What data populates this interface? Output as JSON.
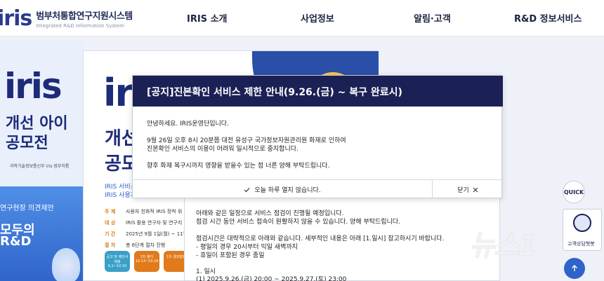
{
  "header": {
    "logo_mark": "iris",
    "logo_title": "범부처통합연구지원시스템",
    "logo_sub": "Integrated R&D Information System",
    "nav": [
      "IRIS 소개",
      "사업정보",
      "알림·고객",
      "R&D 정보서비스"
    ]
  },
  "banner_left": {
    "brand": "iris",
    "line1": "개선 아이",
    "line2": "공모전",
    "org": "과학기술정보통신부  iris 범부처통",
    "blue_t1": "연구현장 의견제안",
    "blue_t2": "모두의",
    "blue_t3": "R&D"
  },
  "card1": {
    "brand": "iris",
    "big1": "개선",
    "big2": "공모",
    "sub1": "IRIS 서비스",
    "sub2": "IRIS 사용자",
    "rows": [
      {
        "k": "주  제",
        "v": "사용자 친화적 IRIS 정착 위"
      },
      {
        "k": "대  상",
        "v": "IRIS 활용 연구자 및 연구지"
      },
      {
        "k": "기  간",
        "v": "2025년 9월 1일(월) ~ 11월"
      },
      {
        "k": "절  차",
        "v": "총 6단계 절차 진행"
      }
    ],
    "steps": [
      {
        "label": "공고 및 제안서 제출",
        "date": "9.1~10.10",
        "color": "#3aa0c8"
      },
      {
        "label": "1차 평가",
        "date": "10.13~10.24",
        "color": "#e07a1a"
      },
      {
        "label": "1차 결과발표",
        "date": "",
        "color": "#e07a1a"
      }
    ]
  },
  "card2": {
    "lines": [
      "아래와 같은 일정으로 서비스 점검이 진행될 예정입니다.",
      "점검 시간 동안 서비스 접속이 원활하지 않을 수 있습니다. 양해 부탁드립니다.",
      "점검시간은 대략적으로 아래와 같습니다. 세부적인 내용은 아래 [1.일시] 참고하시기 바랍니다.",
      "- 평일의 경우 20시부터 익일 새벽까지",
      "- 휴일이 포함된 경우 종일",
      "1. 일시",
      "(1) 2025.9.26.(금) 20:00 ~ 2025.9.27.(토) 23:00"
    ]
  },
  "modal": {
    "title": "[공지]진본확인 서비스 제한 안내(9.26.(금) ~ 복구 완료시)",
    "greeting": "안녕하세요. IRIS운영단입니다.",
    "body1": "9월 26일 오후 8시 20분쯤 대전 유성구 국가정보자원관리원 화재로 인하여",
    "body2": "진본확인 서비스의 이용이 어려워 일시적으로 중지합니다.",
    "body3": "향후 화재 복구시까지 영향을 받을수 있는 점 너른 양해 부탁드립니다.",
    "dont_show_label": "오늘 하루 열지 않습니다.",
    "close_label": "닫기"
  },
  "side": {
    "quick_label": "QUICK",
    "chatbot_label": "고객상담챗봇"
  },
  "watermark": "뉴스1",
  "colors": {
    "navy": "#1b2155",
    "brand_blue": "#2b3990",
    "brand_pink": "#e23b7a",
    "accent_blue": "#2f63c9"
  }
}
